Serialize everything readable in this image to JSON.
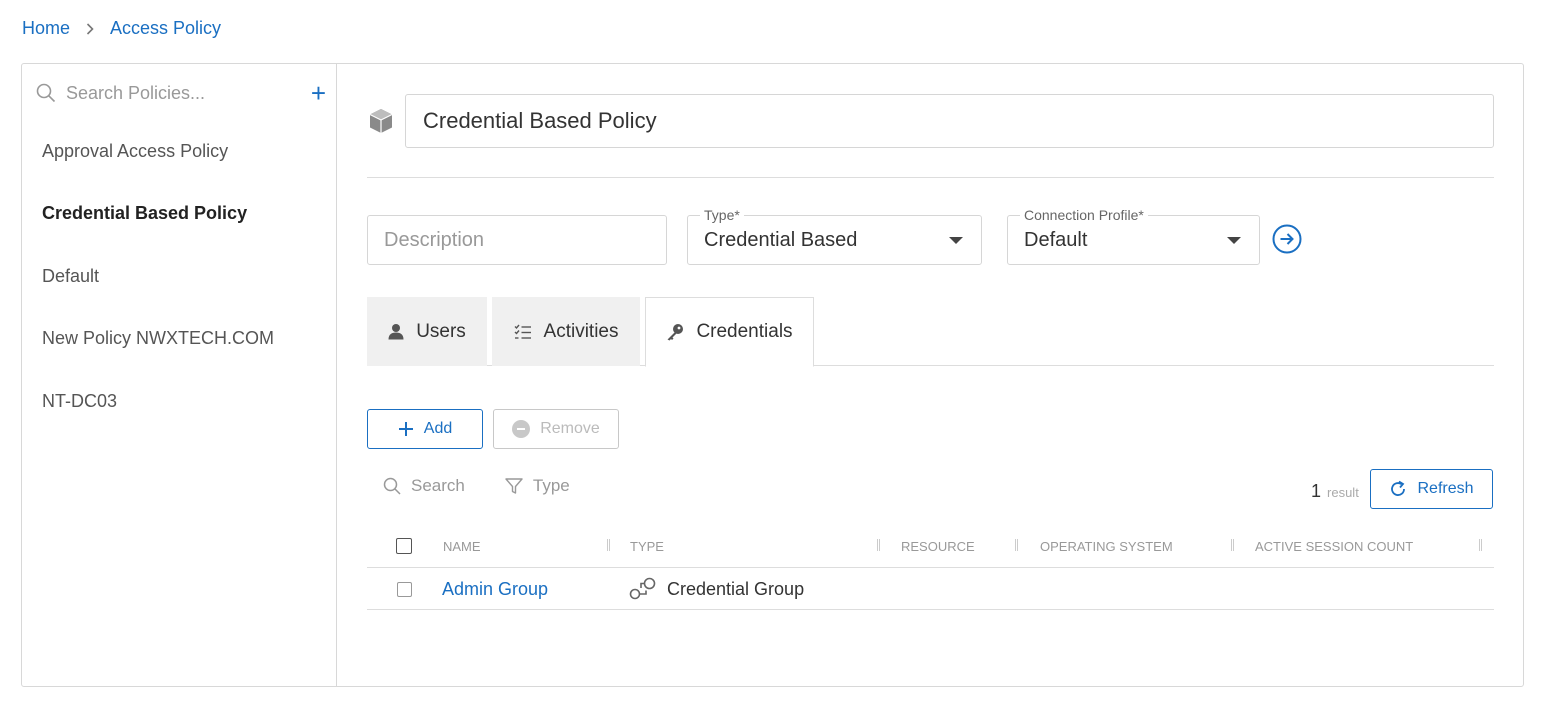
{
  "breadcrumb": {
    "home": "Home",
    "current": "Access Policy"
  },
  "sidebar": {
    "search_placeholder": "Search Policies...",
    "add_label": "+",
    "items": [
      {
        "label": "Approval Access Policy"
      },
      {
        "label": "Credential Based Policy",
        "active": true
      },
      {
        "label": "Default"
      },
      {
        "label": "New Policy NWXTECH.COM"
      },
      {
        "label": "NT-DC03"
      }
    ]
  },
  "policy": {
    "name": "Credential Based Policy",
    "description_placeholder": "Description",
    "type": {
      "label": "Type*",
      "value": "Credential Based"
    },
    "connection_profile": {
      "label": "Connection Profile*",
      "value": "Default"
    }
  },
  "tabs": [
    {
      "label": "Users",
      "icon": "user-icon"
    },
    {
      "label": "Activities",
      "icon": "checklist-icon"
    },
    {
      "label": "Credentials",
      "icon": "key-icon",
      "active": true
    }
  ],
  "actions": {
    "add": "Add",
    "remove": "Remove",
    "refresh": "Refresh"
  },
  "filters": {
    "search": "Search",
    "type": "Type"
  },
  "results": {
    "count": "1",
    "label": "result"
  },
  "table": {
    "columns": [
      "NAME",
      "TYPE",
      "RESOURCE",
      "OPERATING SYSTEM",
      "ACTIVE SESSION COUNT"
    ],
    "rows": [
      {
        "name": "Admin Group",
        "type": "Credential Group",
        "resource": "",
        "os": "",
        "sessions": ""
      }
    ]
  },
  "colors": {
    "accent": "#1a6fc2",
    "border": "#d8d8d8",
    "tab_inactive": "#f0f0f0"
  }
}
